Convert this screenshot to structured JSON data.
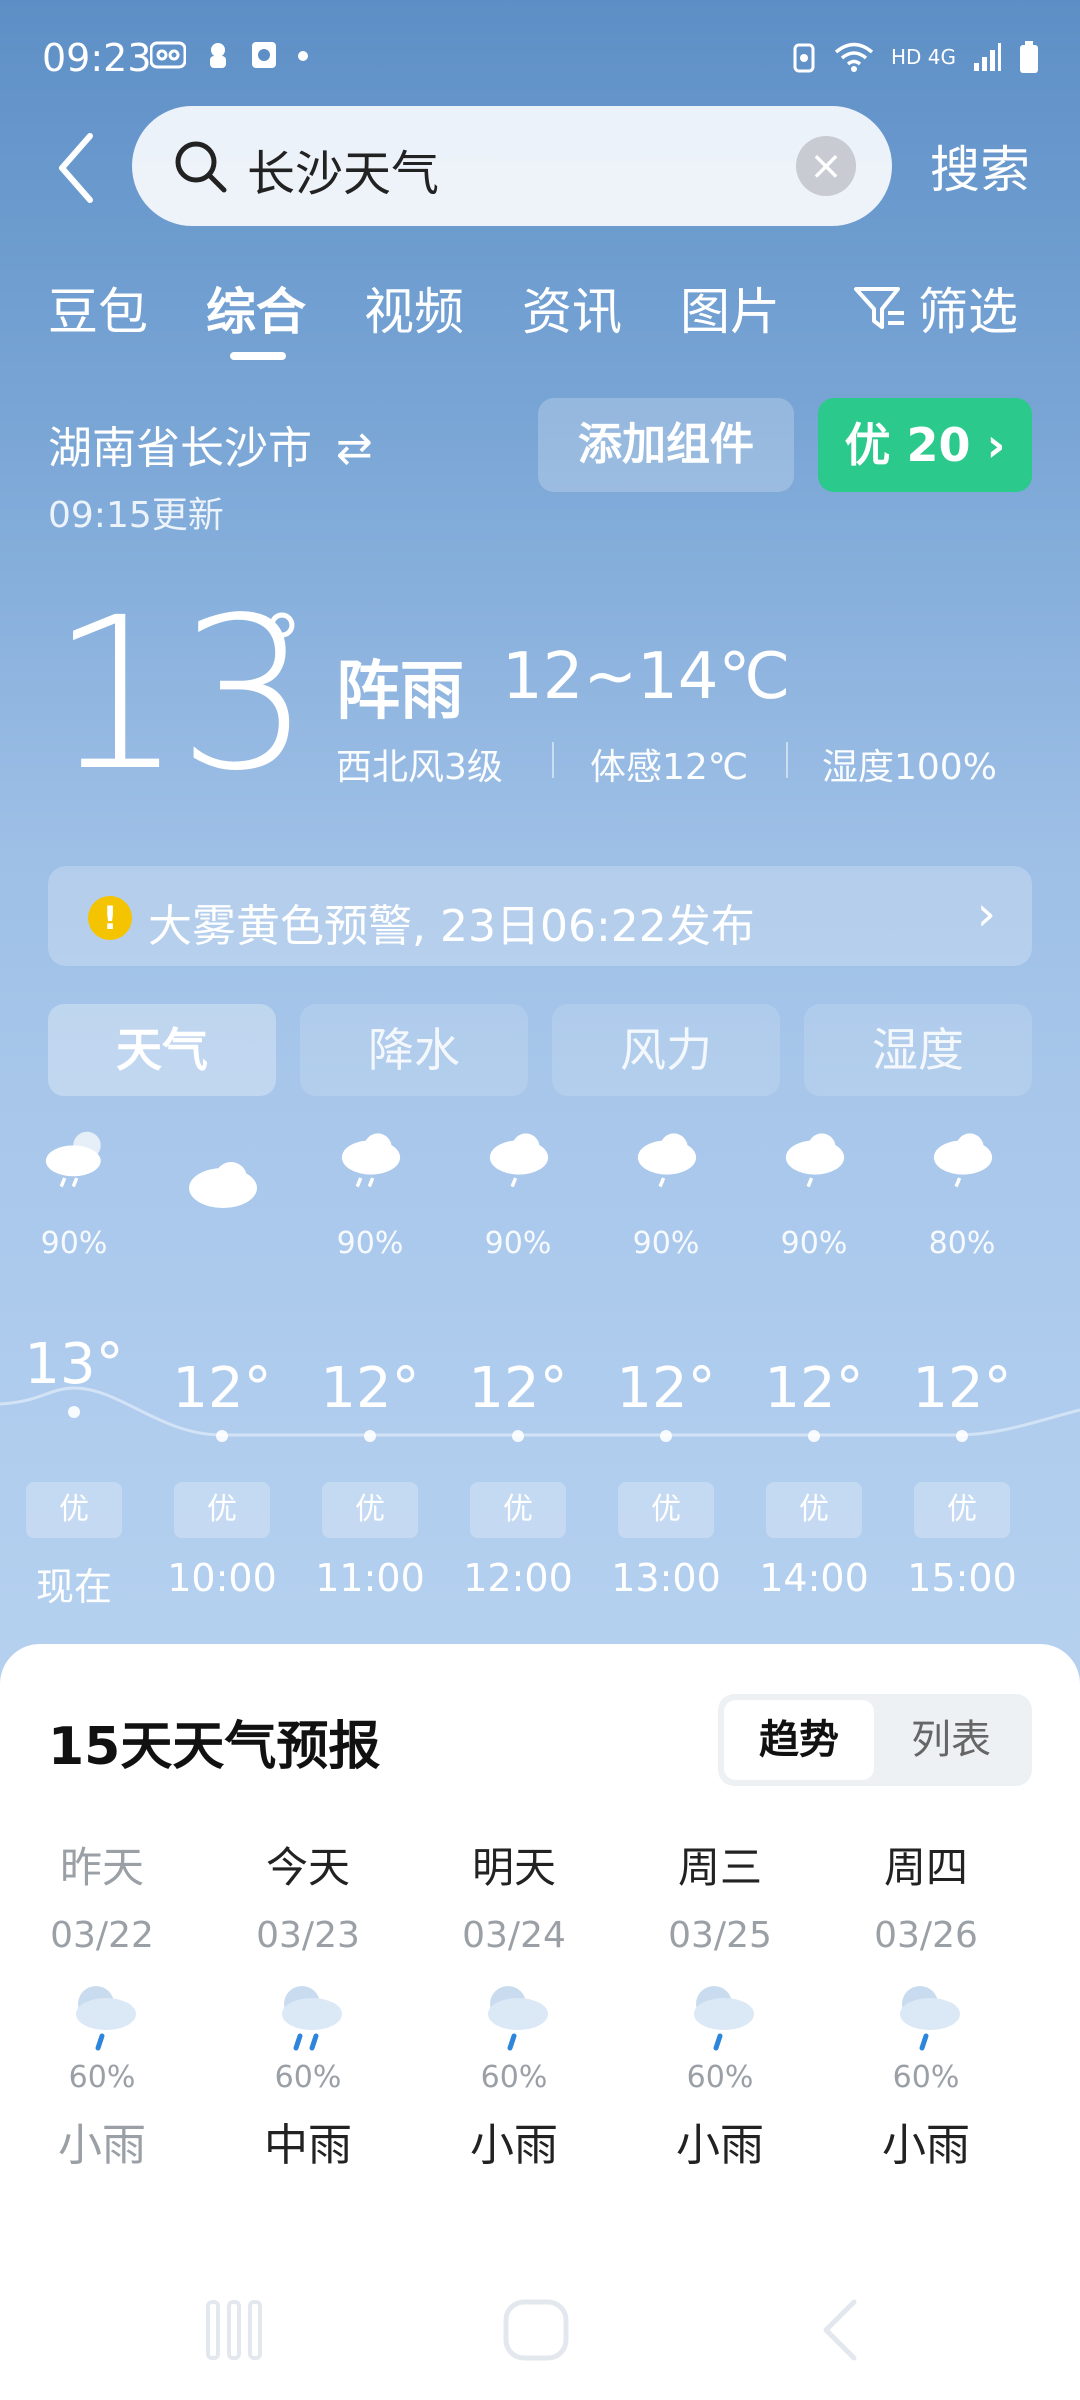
{
  "status": {
    "time": "09:23",
    "left_icons": [
      "voicemail-icon",
      "app-icon",
      "app-icon-2",
      "dot"
    ],
    "network": "HD 4G"
  },
  "search": {
    "query": "长沙天气",
    "button_label": "搜索"
  },
  "tabs": [
    {
      "label": "豆包"
    },
    {
      "label": "综合"
    },
    {
      "label": "视频"
    },
    {
      "label": "资讯"
    },
    {
      "label": "图片"
    },
    {
      "label": "筛选"
    }
  ],
  "weather": {
    "location": "湖南省长沙市",
    "update_time": "09:15更新",
    "add_widget": "添加组件",
    "aqi": "优 20 ›",
    "temp": "13",
    "condition": "阵雨",
    "range": "12~14℃",
    "wind": "西北风3级",
    "feels_like": "体感12℃",
    "humidity": "湿度100%",
    "alert": "大雾黄色预警, 23日06:22发布",
    "subtabs": [
      {
        "label": "天气"
      },
      {
        "label": "降水"
      },
      {
        "label": "风力"
      },
      {
        "label": "湿度"
      }
    ],
    "hourly": [
      {
        "precip": "90%",
        "temp": "13°",
        "aqi": "优",
        "time": "现在",
        "icon": "rain-cloud-icon"
      },
      {
        "precip": "",
        "temp": "12°",
        "aqi": "优",
        "time": "10:00",
        "icon": "cloud-icon"
      },
      {
        "precip": "90%",
        "temp": "12°",
        "aqi": "优",
        "time": "11:00",
        "icon": "rain-cloud-icon"
      },
      {
        "precip": "90%",
        "temp": "12°",
        "aqi": "优",
        "time": "12:00",
        "icon": "rain-cloud-icon"
      },
      {
        "precip": "90%",
        "temp": "12°",
        "aqi": "优",
        "time": "13:00",
        "icon": "rain-cloud-icon"
      },
      {
        "precip": "90%",
        "temp": "12°",
        "aqi": "优",
        "time": "14:00",
        "icon": "rain-cloud-icon"
      },
      {
        "precip": "80%",
        "temp": "12°",
        "aqi": "优",
        "time": "15:00",
        "icon": "rain-cloud-icon"
      }
    ]
  },
  "forecast": {
    "title": "15天天气预报",
    "toggle": [
      {
        "label": "趋势"
      },
      {
        "label": "列表"
      }
    ],
    "days": [
      {
        "name": "昨天",
        "date": "03/22",
        "prob": "60%",
        "cond": "小雨"
      },
      {
        "name": "今天",
        "date": "03/23",
        "prob": "60%",
        "cond": "中雨"
      },
      {
        "name": "明天",
        "date": "03/24",
        "prob": "60%",
        "cond": "小雨"
      },
      {
        "name": "周三",
        "date": "03/25",
        "prob": "60%",
        "cond": "小雨"
      },
      {
        "name": "周四",
        "date": "03/26",
        "prob": "60%",
        "cond": "小雨"
      }
    ]
  }
}
